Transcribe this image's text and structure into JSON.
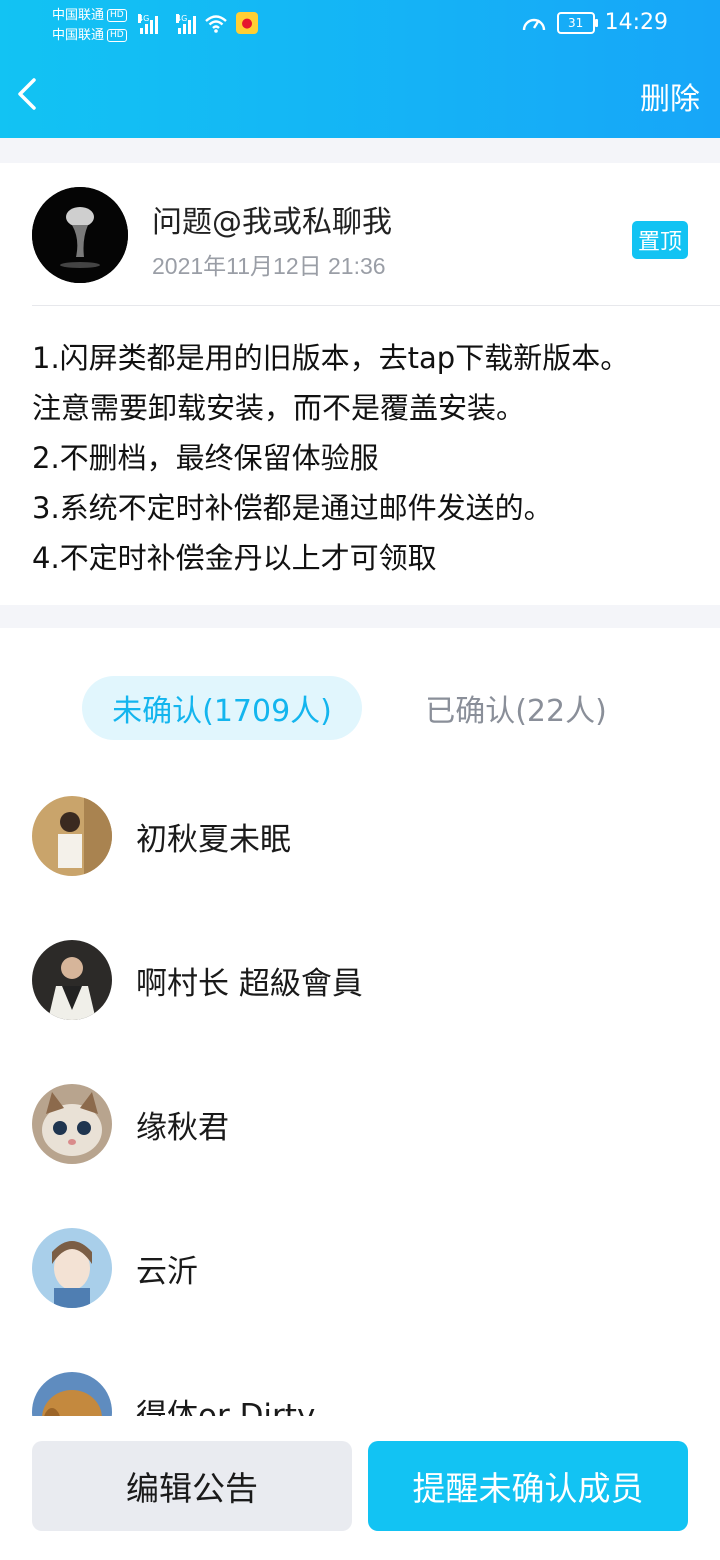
{
  "status_bar": {
    "carrier1": "中国联通",
    "carrier2": "中国联通",
    "hd": "HD",
    "net1": "4G",
    "net2": "4G",
    "battery": "31",
    "time": "14:29"
  },
  "header": {
    "back_icon": "chevron-left-icon",
    "delete_label": "删除"
  },
  "notice": {
    "author": "问题@我或私聊我",
    "date": "2021年11月12日 21:36",
    "pin_label": "置顶",
    "lines": [
      "1.闪屏类都是用的旧版本，去tap下载新版本。",
      "注意需要卸载安装，而不是覆盖安装。",
      "2.不删档，最终保留体验服",
      "3.系统不定时补偿都是通过邮件发送的。",
      "4.不定时补偿金丹以上才可领取"
    ]
  },
  "tabs": {
    "unconfirmed": "未确认(1709人)",
    "confirmed": "已确认(22人)"
  },
  "members": [
    {
      "name": "初秋夏未眠"
    },
    {
      "name": "啊村长 超級會員"
    },
    {
      "name": "缘秋君"
    },
    {
      "name": "云沂"
    },
    {
      "name": "得体or Dirty"
    }
  ],
  "actions": {
    "edit": "编辑公告",
    "remind": "提醒未确认成员"
  },
  "colors": {
    "accent": "#12c3f3",
    "tab_bg": "#e1f6fd",
    "secondary_button": "#e9ebf0"
  }
}
